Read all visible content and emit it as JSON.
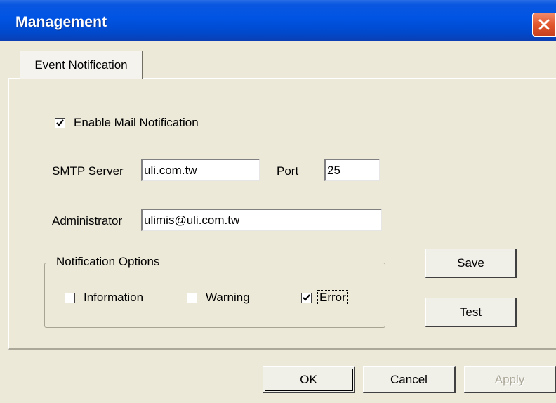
{
  "window": {
    "title": "Management"
  },
  "tabs": [
    {
      "label": "Event Notification"
    }
  ],
  "form": {
    "enable_mail": {
      "label": "Enable Mail Notification",
      "checked": true
    },
    "smtp_server": {
      "label": "SMTP Server",
      "value": "uli.com.tw"
    },
    "port": {
      "label": "Port",
      "value": "25"
    },
    "administrator": {
      "label": "Administrator",
      "value": "ulimis@uli.com.tw"
    },
    "notification_options": {
      "legend": "Notification Options",
      "information": {
        "label": "Information",
        "checked": false
      },
      "warning": {
        "label": "Warning",
        "checked": false
      },
      "error": {
        "label": "Error",
        "checked": true
      }
    }
  },
  "buttons": {
    "save": "Save",
    "test": "Test",
    "ok": "OK",
    "cancel": "Cancel",
    "apply": "Apply"
  },
  "colors": {
    "titlebar": "#0054e3",
    "dialog_bg": "#ece9d8",
    "close_button": "#e2562c"
  }
}
